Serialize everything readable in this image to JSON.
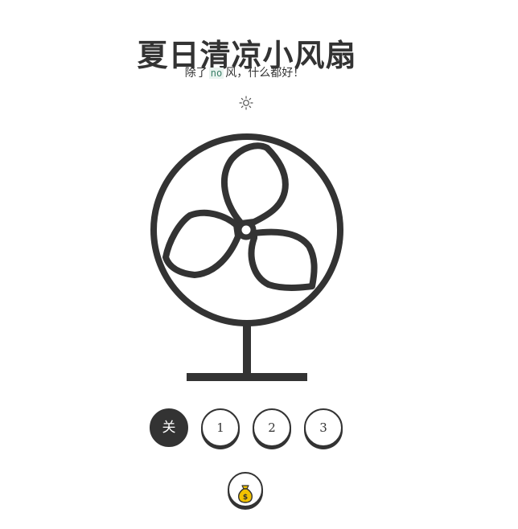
{
  "header": {
    "title": "夏日清凉小风扇",
    "subtitle_before": "除了",
    "subtitle_highlight": "no",
    "subtitle_after": "风，什么都好！"
  },
  "theme_toggle": {
    "icon": "sun-icon"
  },
  "fan": {
    "icon": "desk-fan-illustration",
    "blades": 3
  },
  "speed_controls": {
    "off_label": "关",
    "speed_1_label": "1",
    "speed_2_label": "2",
    "speed_3_label": "3",
    "active": "关"
  },
  "tip_button": {
    "icon": "money-bag-icon"
  },
  "colors": {
    "ink": "#333333",
    "background": "#ffffff",
    "highlight_bg": "#e9f3ef",
    "highlight_text": "#3a7f67",
    "money_bag": "#f2c200"
  }
}
